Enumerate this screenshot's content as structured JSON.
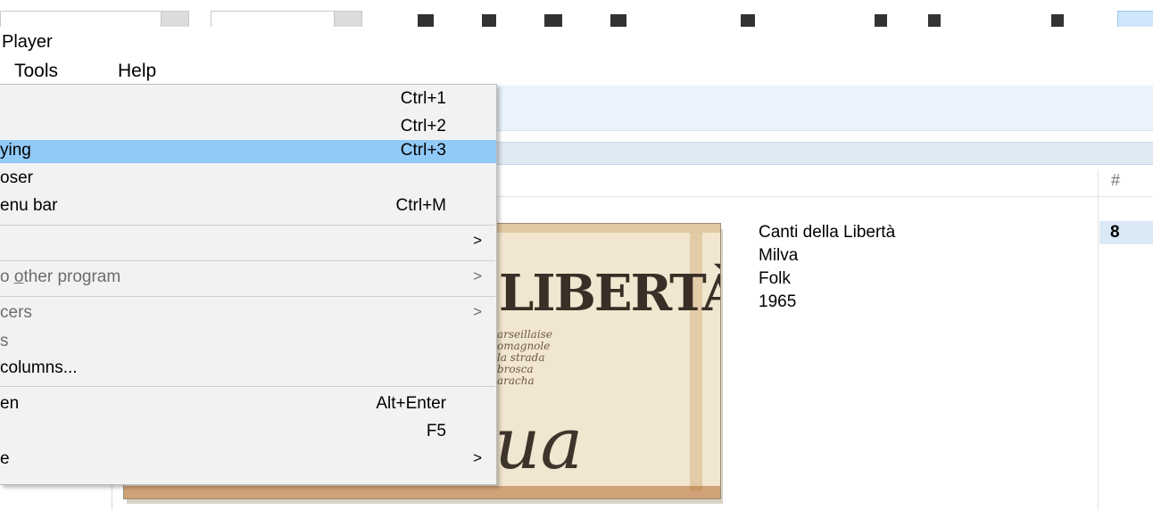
{
  "app": {
    "title": "Player"
  },
  "menu_bar": {
    "tools": "Tools",
    "help": "Help"
  },
  "dropdown": {
    "items": [
      {
        "label": "",
        "shortcut": "Ctrl+1"
      },
      {
        "label": "",
        "shortcut": "Ctrl+2"
      },
      {
        "label": "ying",
        "shortcut": "Ctrl+3",
        "highlighted": true
      },
      {
        "label": "oser",
        "shortcut": ""
      },
      {
        "label": "enu bar",
        "shortcut": "Ctrl+M"
      },
      {
        "label": "",
        "arrow": ">"
      },
      {
        "label_pre": "o ",
        "label_u": "o",
        "label_post": "ther program",
        "arrow": ">",
        "disabled": true
      },
      {
        "label": "cers",
        "arrow": ">",
        "disabled": true
      },
      {
        "label": "s",
        "disabled": true
      },
      {
        "label": "columns..."
      },
      {
        "label": "en",
        "shortcut": "Alt+Enter"
      },
      {
        "label": "",
        "shortcut": "F5"
      },
      {
        "label": "e",
        "arrow": ">"
      }
    ]
  },
  "list": {
    "header_number": "#",
    "album": "Canti della Libertà",
    "artist": "Milva",
    "genre": "Folk",
    "year": "1965",
    "track_number": "8"
  },
  "album_art": {
    "title_text": "LIBERTÀ",
    "lines": [
      "arseillaise",
      "omagnole",
      "la strada",
      "brosca",
      "aracha"
    ],
    "script_text": "ua"
  },
  "colors": {
    "highlight": "#91c9f7",
    "menu_bg": "#f2f2f2",
    "selection_row": "#dbe9f7"
  }
}
